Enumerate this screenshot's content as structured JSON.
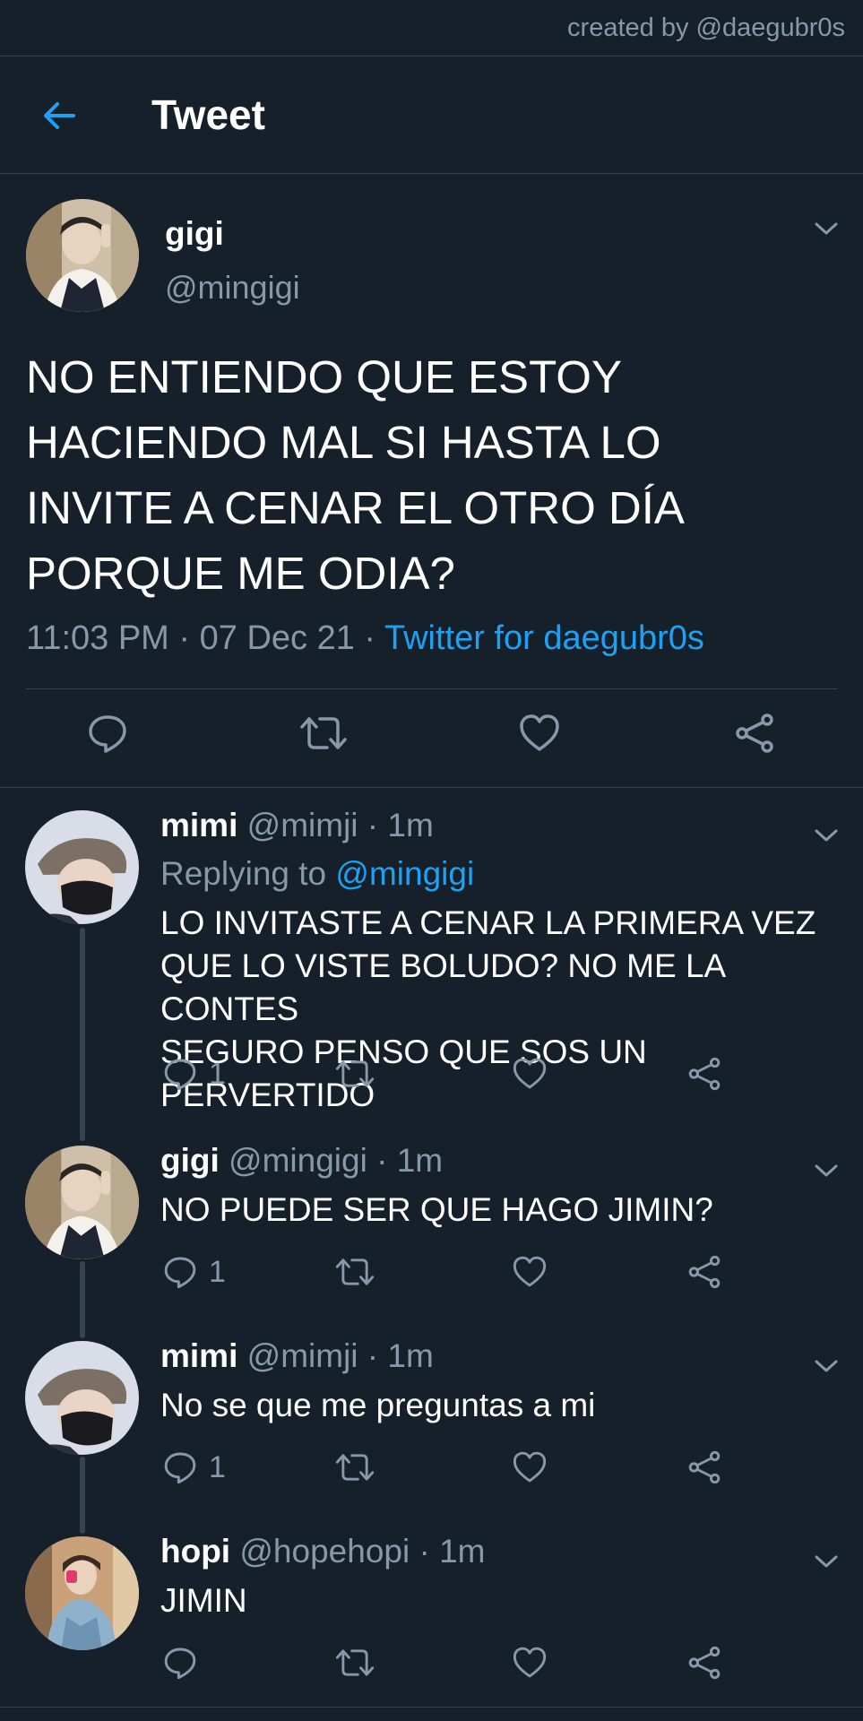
{
  "credit": "created by @daegubr0s",
  "header": {
    "title": "Tweet"
  },
  "main_tweet": {
    "name": "gigi",
    "handle": "@mingigi",
    "text_lines": [
      "NO ENTIENDO QUE ESTOY",
      "HACIENDO MAL SI HASTA LO",
      "INVITE A CENAR EL OTRO DÍA",
      "PORQUE ME ODIA?"
    ],
    "time": "11:03 PM",
    "sep1": " · ",
    "date": "07 Dec 21",
    "sep2": " · ",
    "source": "Twitter for daegubr0s"
  },
  "replies": [
    {
      "name": "mimi",
      "handle": "@mimji",
      "dot": " · ",
      "time": "1m",
      "replying_prefix": "Replying to ",
      "replying_to": "@mingigi",
      "text_lines": [
        "LO INVITASTE A CENAR LA PRIMERA VEZ",
        "QUE LO VISTE BOLUDO? NO ME LA CONTES",
        "SEGURO PENSO QUE SOS UN PERVERTIDO"
      ],
      "reply_count": "1"
    },
    {
      "name": "gigi",
      "handle": "@mingigi",
      "dot": " · ",
      "time": "1m",
      "text_lines": [
        "NO PUEDE SER QUE HAGO JIMIN?"
      ],
      "reply_count": "1"
    },
    {
      "name": "mimi",
      "handle": "@mimji",
      "dot": " · ",
      "time": "1m",
      "text_lines": [
        "No se que me preguntas a mi"
      ],
      "reply_count": "1"
    },
    {
      "name": "hopi",
      "handle": "@hopehopi",
      "dot": " · ",
      "time": "1m",
      "text_lines": [
        "JIMIN"
      ],
      "reply_count": ""
    }
  ],
  "icons": {
    "back": "arrow-left-icon",
    "menu": "chevron-down-icon",
    "reply": "speech-bubble-icon",
    "retweet": "retweet-icon",
    "like": "heart-icon",
    "share": "share-icon"
  },
  "colors": {
    "background": "#15202b",
    "accent": "#1da1f2",
    "secondary_text": "#8899a6",
    "divider": "#38444d"
  }
}
